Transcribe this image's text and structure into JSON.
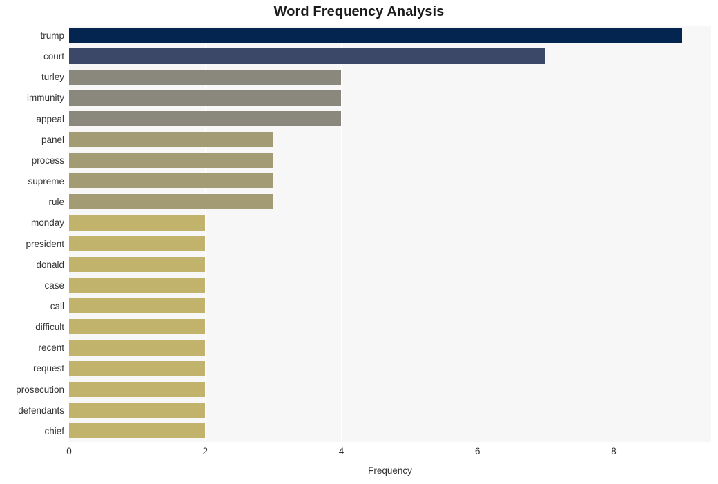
{
  "chart_data": {
    "type": "bar",
    "orientation": "horizontal",
    "title": "Word Frequency Analysis",
    "xlabel": "Frequency",
    "ylabel": "",
    "xlim": [
      0,
      9.43
    ],
    "xticks": [
      0,
      2,
      4,
      6,
      8
    ],
    "xtick_labels": [
      "0",
      "2",
      "4",
      "6",
      "8"
    ],
    "grid": "vertical",
    "legend": "none",
    "categories": [
      "trump",
      "court",
      "turley",
      "immunity",
      "appeal",
      "panel",
      "process",
      "supreme",
      "rule",
      "monday",
      "president",
      "donald",
      "case",
      "call",
      "difficult",
      "recent",
      "request",
      "prosecution",
      "defendants",
      "chief"
    ],
    "values": [
      9,
      7,
      4,
      4,
      4,
      3,
      3,
      3,
      3,
      2,
      2,
      2,
      2,
      2,
      2,
      2,
      2,
      2,
      2,
      2
    ],
    "bar_colors": [
      "#03254f",
      "#3b4868",
      "#8a877c",
      "#8a877c",
      "#8a877c",
      "#a39b73",
      "#a39b73",
      "#a39b73",
      "#a39b73",
      "#c1b36b",
      "#c1b36b",
      "#c1b36b",
      "#c1b36b",
      "#c1b36b",
      "#c1b36b",
      "#c1b36b",
      "#c1b36b",
      "#c1b36b",
      "#c1b36b",
      "#c1b36b"
    ]
  },
  "style": {
    "plot_background": "#f7f7f7",
    "figure_background": "#ffffff",
    "gridline_color": "#ffffff",
    "text_color": "#333333",
    "title_color": "#1a1a1a"
  }
}
